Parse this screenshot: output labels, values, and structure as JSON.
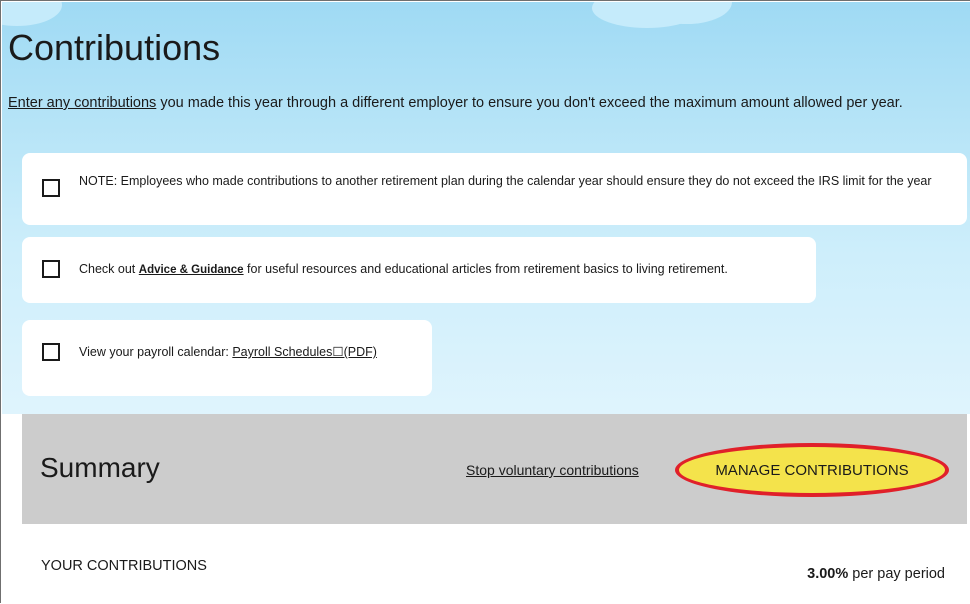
{
  "page": {
    "title": "Contributions",
    "intro_link": "Enter any contributions",
    "intro_rest": " you made this year through a different employer to ensure you don't exceed the maximum amount allowed per year."
  },
  "notes": [
    {
      "text": "NOTE: Employees who made contributions to another retirement plan during the calendar year should ensure they do not exceed the IRS limit for the year"
    },
    {
      "prefix": "Check out ",
      "link": "Advice & Guidance",
      "suffix": " for useful resources and educational articles from retirement basics to living retirement."
    },
    {
      "prefix": "View your payroll calendar: ",
      "link": "Payroll Schedules☐(PDF)"
    }
  ],
  "summary": {
    "title": "Summary",
    "stop_link": "Stop voluntary contributions",
    "manage_button": "MANAGE CONTRIBUTIONS",
    "highlight_color": "#e0202a",
    "button_color": "#f4e34b"
  },
  "contributions": {
    "label": "YOUR CONTRIBUTIONS",
    "value": "3.00%",
    "unit": " per pay period"
  }
}
